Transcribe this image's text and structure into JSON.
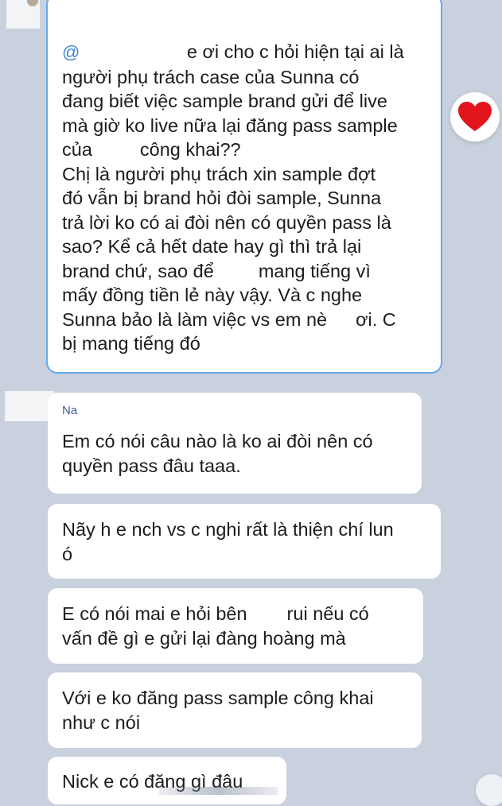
{
  "colors": {
    "background": "#c8d1dd",
    "bubble": "#ffffff",
    "highlight_border": "#66a9e8",
    "mention": "#3a84d6",
    "sender_name": "#3a5f99",
    "heart": "#e2141c"
  },
  "reaction": {
    "icon": "heart-icon"
  },
  "first_message": {
    "mention_symbol": "@",
    "lines": [
      "e ơi cho c hỏi hiện tại ai là",
      "người phụ trách case của Sunna có",
      "đang biết việc sample brand gửi để live",
      "mà giờ ko live nữa lại đăng pass sample",
      "của",
      "công khai??",
      "Chị là người phụ trách xin sample đợt",
      "đó vẫn bị brand hỏi đòi sample, Sunna",
      "trả lời ko có ai đòi nên có quyền pass là",
      "sao? Kể cả hết date hay gì thì trả lại",
      "brand chứ, sao để",
      "mang tiếng vì",
      "mấy đồng tiền lẻ này vậy. Và c nghe",
      "Sunna bảo là làm việc vs em nè",
      "ơi. C",
      "bị mang tiếng đó"
    ]
  },
  "replies": [
    {
      "sender": "Na",
      "lines": [
        "Em có nói câu nào là ko ai đòi nên có",
        "quyền pass đâu taaa."
      ]
    },
    {
      "lines": [
        "Nãy h e nch vs c nghi rất là thiện chí lun",
        "ó"
      ]
    },
    {
      "lines": [
        "E có nói mai e hỏi bên",
        "rui nếu có",
        "vấn đề gì e gửi lại đàng hoàng mà"
      ]
    },
    {
      "lines": [
        "Với e ko đăng pass sample công khai",
        "như c nói"
      ]
    },
    {
      "lines": [
        "Nick e có đăng gì đâu"
      ]
    }
  ]
}
